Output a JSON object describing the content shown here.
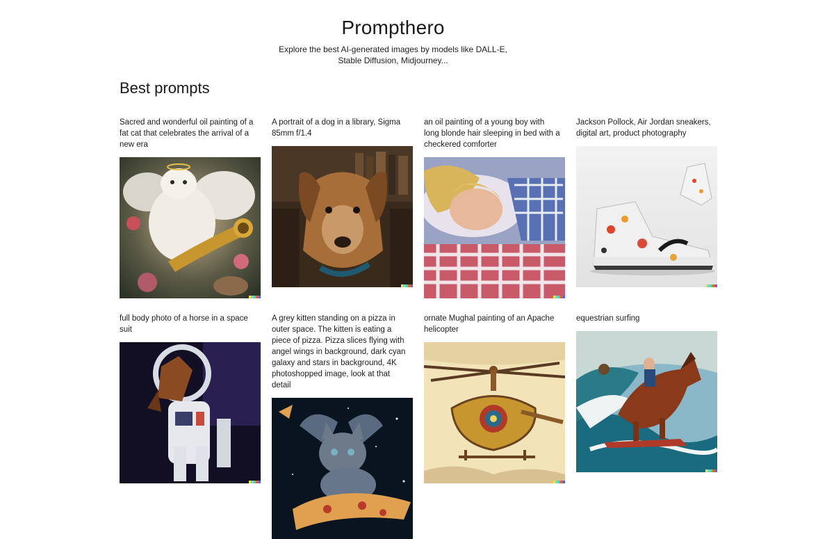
{
  "header": {
    "title": "Prompthero",
    "subtitle": "Explore the best AI-generated images by models like DALL-E, Stable Diffusion, Midjourney..."
  },
  "section": {
    "title": "Best prompts"
  },
  "prompts": [
    {
      "caption": "Sacred and wonderful oil painting of a fat cat that celebrates the arrival of a new era",
      "image": "cat-angel-trumpet-painting"
    },
    {
      "caption": "A portrait of a dog in a library, Sigma 85mm f/1.4",
      "image": "dog-library-portrait"
    },
    {
      "caption": "an oil painting of a young boy with long blonde hair sleeping in bed with a checkered comforter",
      "image": "sleeping-boy-painting"
    },
    {
      "caption": "Jackson Pollock, Air Jordan sneakers, digital art, product photography",
      "image": "pollock-sneakers"
    },
    {
      "caption": "full body photo of a horse in a space suit",
      "image": "horse-space-suit"
    },
    {
      "caption": "A grey kitten standing on a pizza in outer space. The kitten is eating a piece of pizza. Pizza slices flying with angel wings in background, dark cyan galaxy and stars in background, 4K photoshopped image, look at that detail",
      "image": "kitten-pizza-space"
    },
    {
      "caption": "ornate Mughal painting of an Apache helicopter",
      "image": "mughal-helicopter"
    },
    {
      "caption": "equestrian surfing",
      "image": "horse-surfing"
    }
  ],
  "colors": {
    "watermark": [
      "#f5e33a",
      "#6cd6e0",
      "#5fd36b",
      "#ef5a3c",
      "#4b6ae8"
    ]
  }
}
